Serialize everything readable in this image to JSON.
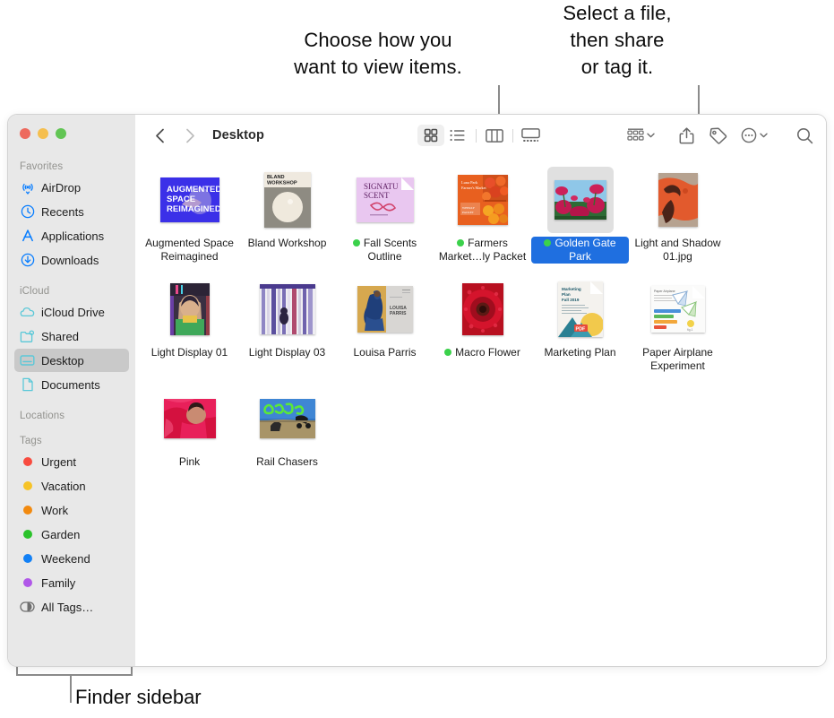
{
  "annotations": {
    "view_callout": "Choose how you\nwant to view items.",
    "share_callout": "Select a file,\nthen share\nor tag it.",
    "sidebar_callout": "Finder sidebar"
  },
  "window": {
    "traffic_lights": [
      {
        "name": "close",
        "color": "#ed6a5e"
      },
      {
        "name": "minimize",
        "color": "#f5bf4f"
      },
      {
        "name": "zoom",
        "color": "#62c554"
      }
    ]
  },
  "toolbar": {
    "back_label": "Back",
    "forward_label": "Forward",
    "path_title": "Desktop",
    "view_modes": [
      {
        "id": "icon",
        "label": "Icon view",
        "active": true
      },
      {
        "id": "list",
        "label": "List view",
        "active": false
      },
      {
        "id": "column",
        "label": "Column view",
        "active": false
      },
      {
        "id": "gallery",
        "label": "Gallery view",
        "active": false
      }
    ],
    "group_label": "Group items",
    "share_label": "Share",
    "tag_label": "Tags",
    "more_label": "More",
    "search_label": "Search"
  },
  "sidebar": {
    "sections": [
      {
        "title": "Favorites",
        "items": [
          {
            "label": "AirDrop",
            "icon": "airdrop-icon",
            "color": "#067cff",
            "selected": false
          },
          {
            "label": "Recents",
            "icon": "clock-icon",
            "color": "#067cff",
            "selected": false
          },
          {
            "label": "Applications",
            "icon": "applications-icon",
            "color": "#067cff",
            "selected": false
          },
          {
            "label": "Downloads",
            "icon": "download-icon",
            "color": "#067cff",
            "selected": false
          }
        ]
      },
      {
        "title": "iCloud",
        "items": [
          {
            "label": "iCloud Drive",
            "icon": "cloud-icon",
            "color": "#5ac8d8",
            "selected": false
          },
          {
            "label": "Shared",
            "icon": "shared-folder-icon",
            "color": "#5ac8d8",
            "selected": false
          },
          {
            "label": "Desktop",
            "icon": "desktop-icon",
            "color": "#5ac8d8",
            "selected": true
          },
          {
            "label": "Documents",
            "icon": "document-icon",
            "color": "#5ac8d8",
            "selected": false
          }
        ]
      },
      {
        "title": "Locations",
        "items": []
      },
      {
        "title": "Tags",
        "items": [
          {
            "label": "Urgent",
            "icon": "tag-dot-icon",
            "color": "#f84b3f",
            "selected": false
          },
          {
            "label": "Vacation",
            "icon": "tag-dot-icon",
            "color": "#f6c327",
            "selected": false
          },
          {
            "label": "Work",
            "icon": "tag-dot-icon",
            "color": "#f28a0f",
            "selected": false
          },
          {
            "label": "Garden",
            "icon": "tag-dot-icon",
            "color": "#2ac22a",
            "selected": false
          },
          {
            "label": "Weekend",
            "icon": "tag-dot-icon",
            "color": "#1280f5",
            "selected": false
          },
          {
            "label": "Family",
            "icon": "tag-dot-icon",
            "color": "#b057e8",
            "selected": false
          },
          {
            "label": "All Tags…",
            "icon": "all-tags-icon",
            "color": "#6e6e6e",
            "selected": false
          }
        ]
      }
    ]
  },
  "files": [
    {
      "name": "Augmented Space Reimagined",
      "tag": null,
      "selected": false,
      "art": "augmented"
    },
    {
      "name": "Bland Workshop",
      "tag": null,
      "selected": false,
      "art": "bland"
    },
    {
      "name": "Fall Scents Outline",
      "tag": "#3bd14b",
      "selected": false,
      "art": "fallscents"
    },
    {
      "name": "Farmers Market…ly Packet",
      "tag": "#3bd14b",
      "selected": false,
      "art": "farmers"
    },
    {
      "name": "Golden Gate Park",
      "tag": "#3bd14b",
      "selected": true,
      "art": "goldengate"
    },
    {
      "name": "Light and Shadow 01.jpg",
      "tag": null,
      "selected": false,
      "art": "lightshadow"
    },
    {
      "name": "Light Display 01",
      "tag": null,
      "selected": false,
      "art": "lightdisplay01"
    },
    {
      "name": "Light Display 03",
      "tag": null,
      "selected": false,
      "art": "lightdisplay03"
    },
    {
      "name": "Louisa Parris",
      "tag": null,
      "selected": false,
      "art": "louisa"
    },
    {
      "name": "Macro Flower",
      "tag": "#3bd14b",
      "selected": false,
      "art": "macroflower"
    },
    {
      "name": "Marketing Plan",
      "tag": null,
      "selected": false,
      "art": "marketing"
    },
    {
      "name": "Paper Airplane Experiment",
      "tag": null,
      "selected": false,
      "art": "paperplane"
    },
    {
      "name": "Pink",
      "tag": null,
      "selected": false,
      "art": "pink"
    },
    {
      "name": "Rail Chasers",
      "tag": null,
      "selected": false,
      "art": "railchasers"
    }
  ]
}
